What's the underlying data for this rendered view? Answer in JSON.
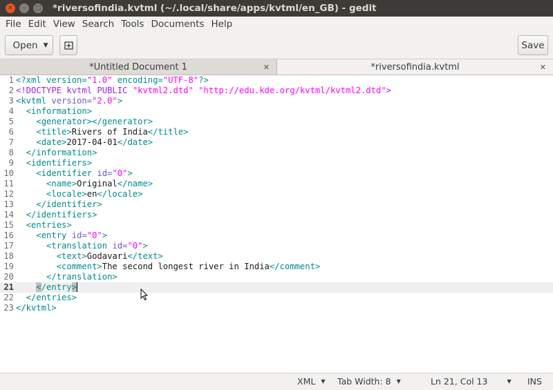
{
  "window": {
    "title": "*riversofindia.kvtml (~/.local/share/apps/kvtml/en_GB) - gedit"
  },
  "menu": [
    "File",
    "Edit",
    "View",
    "Search",
    "Tools",
    "Documents",
    "Help"
  ],
  "toolbar": {
    "open_label": "Open",
    "save_label": "Save"
  },
  "tabs": [
    {
      "label": "*Untitled Document 1",
      "active": false
    },
    {
      "label": "*riversofindia.kvtml",
      "active": true
    }
  ],
  "editor": {
    "current_line": 21,
    "lines": [
      [
        [
          "<?xml version=",
          "t"
        ],
        [
          "\"1.0\"",
          "s"
        ],
        [
          " encoding=",
          "t"
        ],
        [
          "\"UTF-8\"",
          "s"
        ],
        [
          "?>",
          "t"
        ]
      ],
      [
        [
          "<!DOCTYPE kvtml PUBLIC ",
          "d"
        ],
        [
          "\"kvtml2.dtd\"",
          "s"
        ],
        [
          " ",
          "d"
        ],
        [
          "\"http://edu.kde.org/kvtml/kvtml2.dtd\"",
          "s"
        ],
        [
          ">",
          "d"
        ]
      ],
      [
        [
          "<kvtml ",
          "t"
        ],
        [
          "version=",
          "a"
        ],
        [
          "\"2.0\"",
          "s"
        ],
        [
          ">",
          "t"
        ]
      ],
      [
        [
          "  ",
          "x"
        ],
        [
          "<information>",
          "t"
        ]
      ],
      [
        [
          "    ",
          "x"
        ],
        [
          "<generator></generator>",
          "t"
        ]
      ],
      [
        [
          "    ",
          "x"
        ],
        [
          "<title>",
          "t"
        ],
        [
          "Rivers of India",
          "x"
        ],
        [
          "</title>",
          "t"
        ]
      ],
      [
        [
          "    ",
          "x"
        ],
        [
          "<date>",
          "t"
        ],
        [
          "2017-04-01",
          "x"
        ],
        [
          "</date>",
          "t"
        ]
      ],
      [
        [
          "  ",
          "x"
        ],
        [
          "</information>",
          "t"
        ]
      ],
      [
        [
          "  ",
          "x"
        ],
        [
          "<identifiers>",
          "t"
        ]
      ],
      [
        [
          "    ",
          "x"
        ],
        [
          "<identifier ",
          "t"
        ],
        [
          "id=",
          "a"
        ],
        [
          "\"0\"",
          "s"
        ],
        [
          ">",
          "t"
        ]
      ],
      [
        [
          "      ",
          "x"
        ],
        [
          "<name>",
          "t"
        ],
        [
          "Original",
          "x"
        ],
        [
          "</name>",
          "t"
        ]
      ],
      [
        [
          "      ",
          "x"
        ],
        [
          "<locale>",
          "t"
        ],
        [
          "en",
          "x"
        ],
        [
          "</locale>",
          "t"
        ]
      ],
      [
        [
          "    ",
          "x"
        ],
        [
          "</identifier>",
          "t"
        ]
      ],
      [
        [
          "  ",
          "x"
        ],
        [
          "</identifiers>",
          "t"
        ]
      ],
      [
        [
          "  ",
          "x"
        ],
        [
          "<entries>",
          "t"
        ]
      ],
      [
        [
          "    ",
          "x"
        ],
        [
          "<entry ",
          "t"
        ],
        [
          "id=",
          "a"
        ],
        [
          "\"0\"",
          "s"
        ],
        [
          ">",
          "t"
        ]
      ],
      [
        [
          "      ",
          "x"
        ],
        [
          "<translation ",
          "t"
        ],
        [
          "id=",
          "a"
        ],
        [
          "\"0\"",
          "s"
        ],
        [
          ">",
          "t"
        ]
      ],
      [
        [
          "        ",
          "x"
        ],
        [
          "<text>",
          "t"
        ],
        [
          "Godavari",
          "x"
        ],
        [
          "</text>",
          "t"
        ]
      ],
      [
        [
          "        ",
          "x"
        ],
        [
          "<comment>",
          "t"
        ],
        [
          "The second longest river in India",
          "x"
        ],
        [
          "</comment>",
          "t"
        ]
      ],
      [
        [
          "      ",
          "x"
        ],
        [
          "</translation>",
          "t"
        ]
      ],
      [
        [
          "    ",
          "x"
        ],
        [
          "<",
          "b"
        ],
        [
          "/entry",
          "t"
        ],
        [
          ">",
          "b"
        ]
      ],
      [
        [
          "  ",
          "x"
        ],
        [
          "</entries>",
          "t"
        ]
      ],
      [
        [
          "</kvtml>",
          "t"
        ]
      ]
    ]
  },
  "statusbar": {
    "language": "XML",
    "tab_width": "Tab Width: 8",
    "position": "Ln 21, Col 13",
    "mode": "INS"
  },
  "colors": {
    "tag": "#008b8b",
    "attribute": "#6a5acd",
    "string": "#ff00ff",
    "doctype": "#a020f0",
    "text": "#1a1a1a",
    "bracket_highlight_bg": "#c0c0c0"
  }
}
